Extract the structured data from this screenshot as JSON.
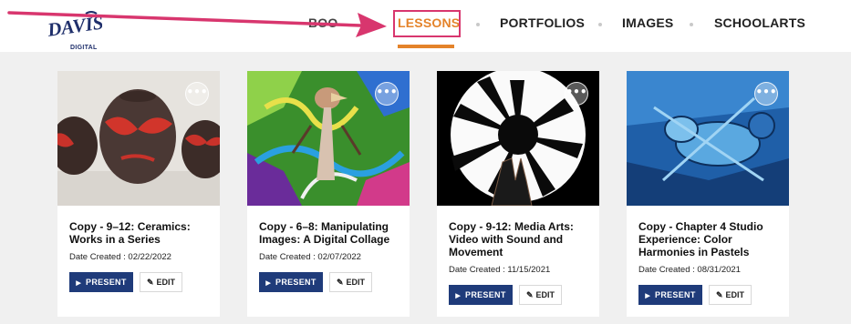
{
  "logo": {
    "text": "DAVIS",
    "sub": "DIGITAL"
  },
  "nav": {
    "partial_label": "BOO",
    "items": [
      {
        "label": "LESSONS",
        "active": true
      },
      {
        "label": "PORTFOLIOS"
      },
      {
        "label": "IMAGES"
      },
      {
        "label": "SCHOOLARTS"
      }
    ]
  },
  "colors": {
    "accent": "#e4832a",
    "primary_button": "#1f3b7a",
    "highlight": "#d8366e"
  },
  "cards": [
    {
      "title": "Copy - 9–12: Ceramics: Works in a Series",
      "date": "Date Created : 02/22/2022",
      "present": "PRESENT",
      "edit": "EDIT",
      "more": "•••"
    },
    {
      "title": "Copy - 6–8: Manipulating Images: A Digital Collage",
      "date": "Date Created : 02/07/2022",
      "present": "PRESENT",
      "edit": "EDIT",
      "more": "•••"
    },
    {
      "title": "Copy - 9-12: Media Arts: Video with Sound and Movement",
      "date": "Date Created : 11/15/2021",
      "present": "PRESENT",
      "edit": "EDIT",
      "more": "•••"
    },
    {
      "title": "Copy - Chapter 4 Studio Experience: Color Harmonies in Pastels",
      "date": "Date Created : 08/31/2021",
      "present": "PRESENT",
      "edit": "EDIT",
      "more": "•••"
    }
  ],
  "icons": {
    "present": "play-icon",
    "edit": "pencil-icon",
    "more": "ellipsis-icon"
  }
}
